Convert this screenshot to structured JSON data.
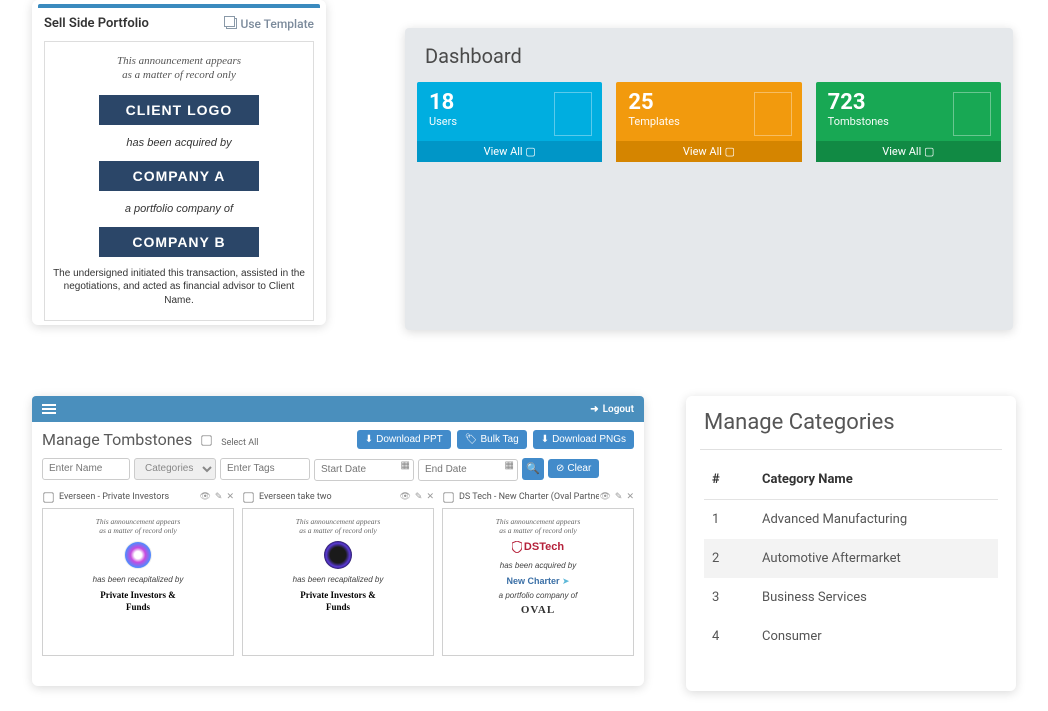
{
  "template_card": {
    "title": "Sell Side Portfolio",
    "use_template_label": "Use Template",
    "announcement_line1": "This announcement appears",
    "announcement_line2": "as a matter of record only",
    "client_logo": "CLIENT LOGO",
    "acquired_by": "has been acquired by",
    "company_a": "COMPANY A",
    "portfolio_of": "a portfolio company of",
    "company_b": "COMPANY B",
    "footer": "The undersigned initiated this transaction, assisted in the negotiations, and acted as financial advisor to Client Name."
  },
  "dashboard": {
    "title": "Dashboard",
    "view_all": "View All ▢",
    "stats": [
      {
        "value": "18",
        "label": "Users",
        "color": "blue"
      },
      {
        "value": "25",
        "label": "Templates",
        "color": "orange"
      },
      {
        "value": "723",
        "label": "Tombstones",
        "color": "green"
      }
    ]
  },
  "tombstones": {
    "logout_label": "Logout",
    "title": "Manage Tombstones",
    "select_all": "Select All",
    "buttons": {
      "download_ppt": "Download PPT",
      "bulk_tag": "Bulk Tag",
      "download_pngs": "Download PNGs",
      "clear": "Clear"
    },
    "filters": {
      "name_placeholder": "Enter Name",
      "categories_placeholder": "Categories",
      "tags_placeholder": "Enter Tags",
      "start_date_placeholder": "Start Date",
      "end_date_placeholder": "End Date"
    },
    "items": [
      {
        "name": "Everseen - Private Investors",
        "ann1": "This announcement appears",
        "ann2": "as a matter of record only",
        "txt1": "has been recapitalized by",
        "strong1": "Private Investors &",
        "strong2": "Funds"
      },
      {
        "name": "Everseen take two",
        "ann1": "This announcement appears",
        "ann2": "as a matter of record only",
        "txt1": "has been recapitalized by",
        "strong1": "Private Investors &",
        "strong2": "Funds"
      },
      {
        "name": "DS Tech - New Charter (Oval Partners)",
        "ann1": "This announcement appears",
        "ann2": "as a matter of record only",
        "txt1": "has been acquired by",
        "txt2": "a portfolio company of",
        "dstech": "DSTech",
        "newcharter": "New Charter",
        "oval": "OVAL"
      }
    ]
  },
  "categories": {
    "title": "Manage Categories",
    "col_num": "#",
    "col_name": "Category Name",
    "rows": [
      {
        "num": "1",
        "name": "Advanced Manufacturing"
      },
      {
        "num": "2",
        "name": "Automotive Aftermarket"
      },
      {
        "num": "3",
        "name": "Business Services"
      },
      {
        "num": "4",
        "name": "Consumer"
      }
    ]
  }
}
